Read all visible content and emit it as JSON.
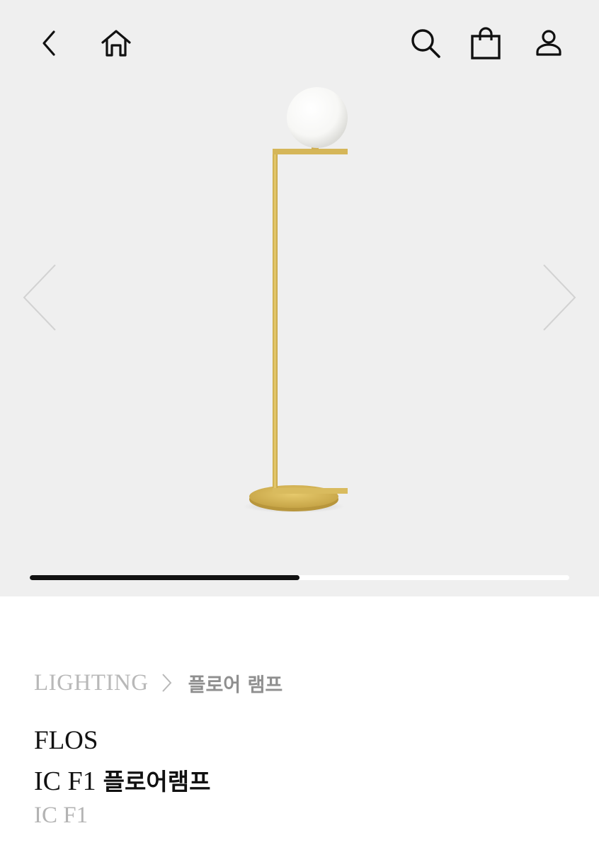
{
  "header": {
    "icons": [
      "back-icon",
      "home-icon",
      "search-icon",
      "shopping-bag-icon",
      "user-icon"
    ]
  },
  "gallery": {
    "progress_fraction": 0.5,
    "image": "floor-lamp-brass-with-white-glass-globe"
  },
  "breadcrumb": {
    "category": "LIGHTING",
    "subcategory": "플로어 램프"
  },
  "product": {
    "brand": "FLOS",
    "name_model": "IC F1",
    "name_type": "플로어램프",
    "model": "IC F1"
  },
  "colors": {
    "gallery_bg": "#efefef",
    "brass": "#d9b957",
    "progress": "#111111"
  }
}
